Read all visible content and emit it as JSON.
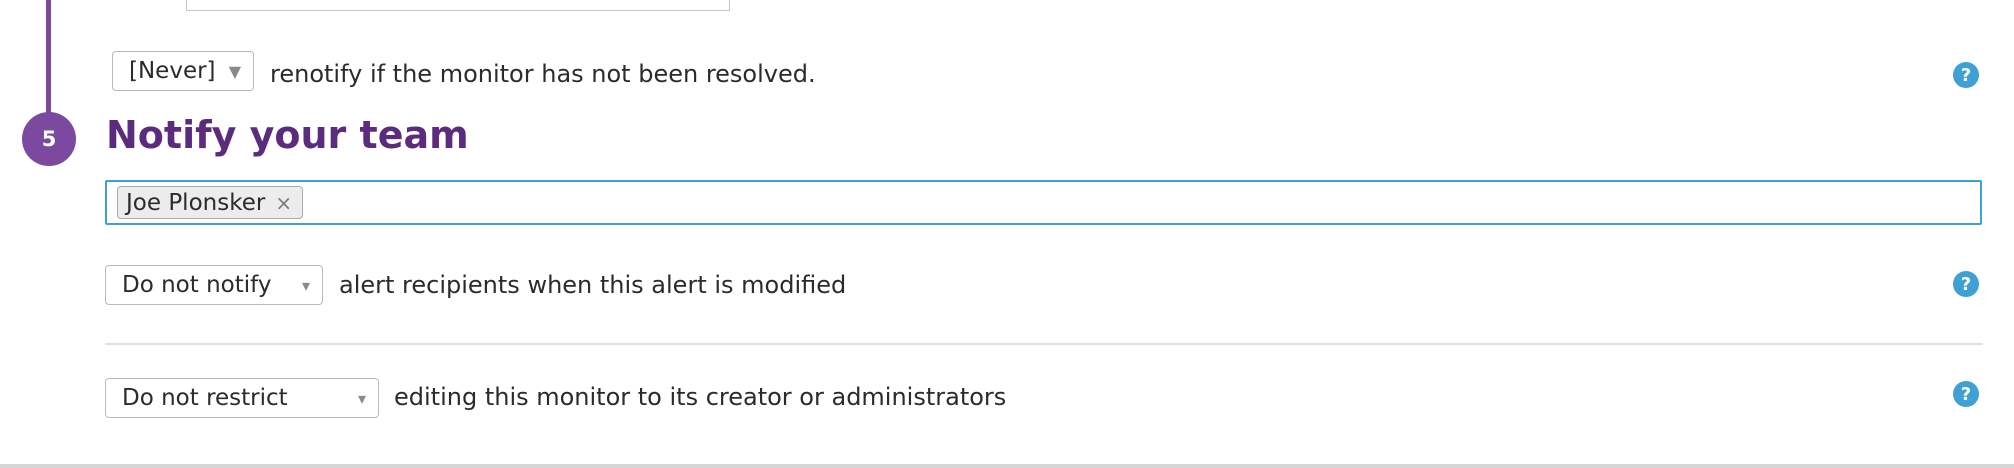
{
  "step": {
    "number": "5",
    "title": "Notify your team"
  },
  "renotify": {
    "select_value": "[Never]",
    "text": "renotify if the monitor has not been resolved."
  },
  "recipients": {
    "tags": [
      {
        "name": "Joe Plonsker",
        "remove": "×"
      }
    ]
  },
  "modify_notify": {
    "select_value": "Do not notify",
    "text": "alert recipients when this alert is modified"
  },
  "restrict": {
    "select_value": "Do not restrict",
    "text": "editing this monitor to its creator or administrators"
  },
  "icons": {
    "help": "?",
    "caret_down_a": "▼",
    "caret_down_b": "▾"
  },
  "colors": {
    "step_purple": "#7b49a0",
    "title_purple": "#5b2b7d",
    "focus_blue": "#3ea0d3",
    "help_blue": "#3ea0d3"
  }
}
